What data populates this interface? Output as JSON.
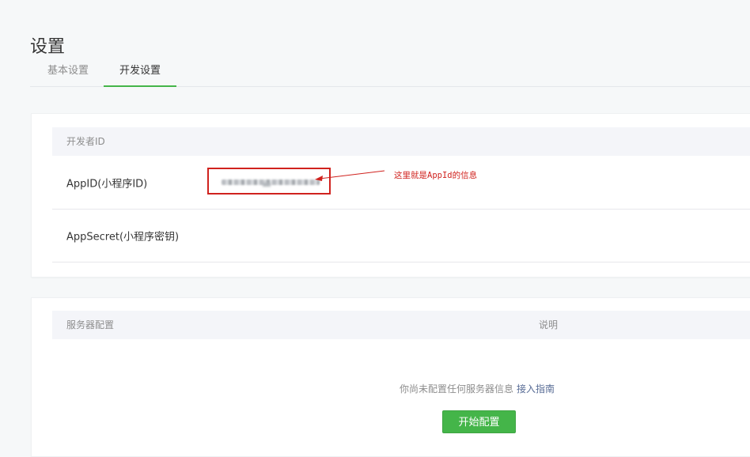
{
  "page": {
    "title": "设置"
  },
  "tabs": [
    {
      "label": "基本设置",
      "active": false
    },
    {
      "label": "开发设置",
      "active": true
    }
  ],
  "developer_id": {
    "section_header": "开发者ID",
    "rows": [
      {
        "label": "AppID(小程序ID)",
        "value": "(blurred)"
      },
      {
        "label": "AppSecret(小程序密钥)",
        "value": ""
      }
    ]
  },
  "annotation": {
    "text": "这里就是AppId的信息",
    "color": "#d0221e"
  },
  "server_config": {
    "columns": [
      "服务器配置",
      "说明"
    ],
    "empty_text": "你尚未配置任何服务器信息",
    "guide_link": "接入指南",
    "start_button": "开始配置"
  },
  "colors": {
    "accent": "#44b549",
    "link": "#576b95",
    "highlight": "#d0221e"
  }
}
